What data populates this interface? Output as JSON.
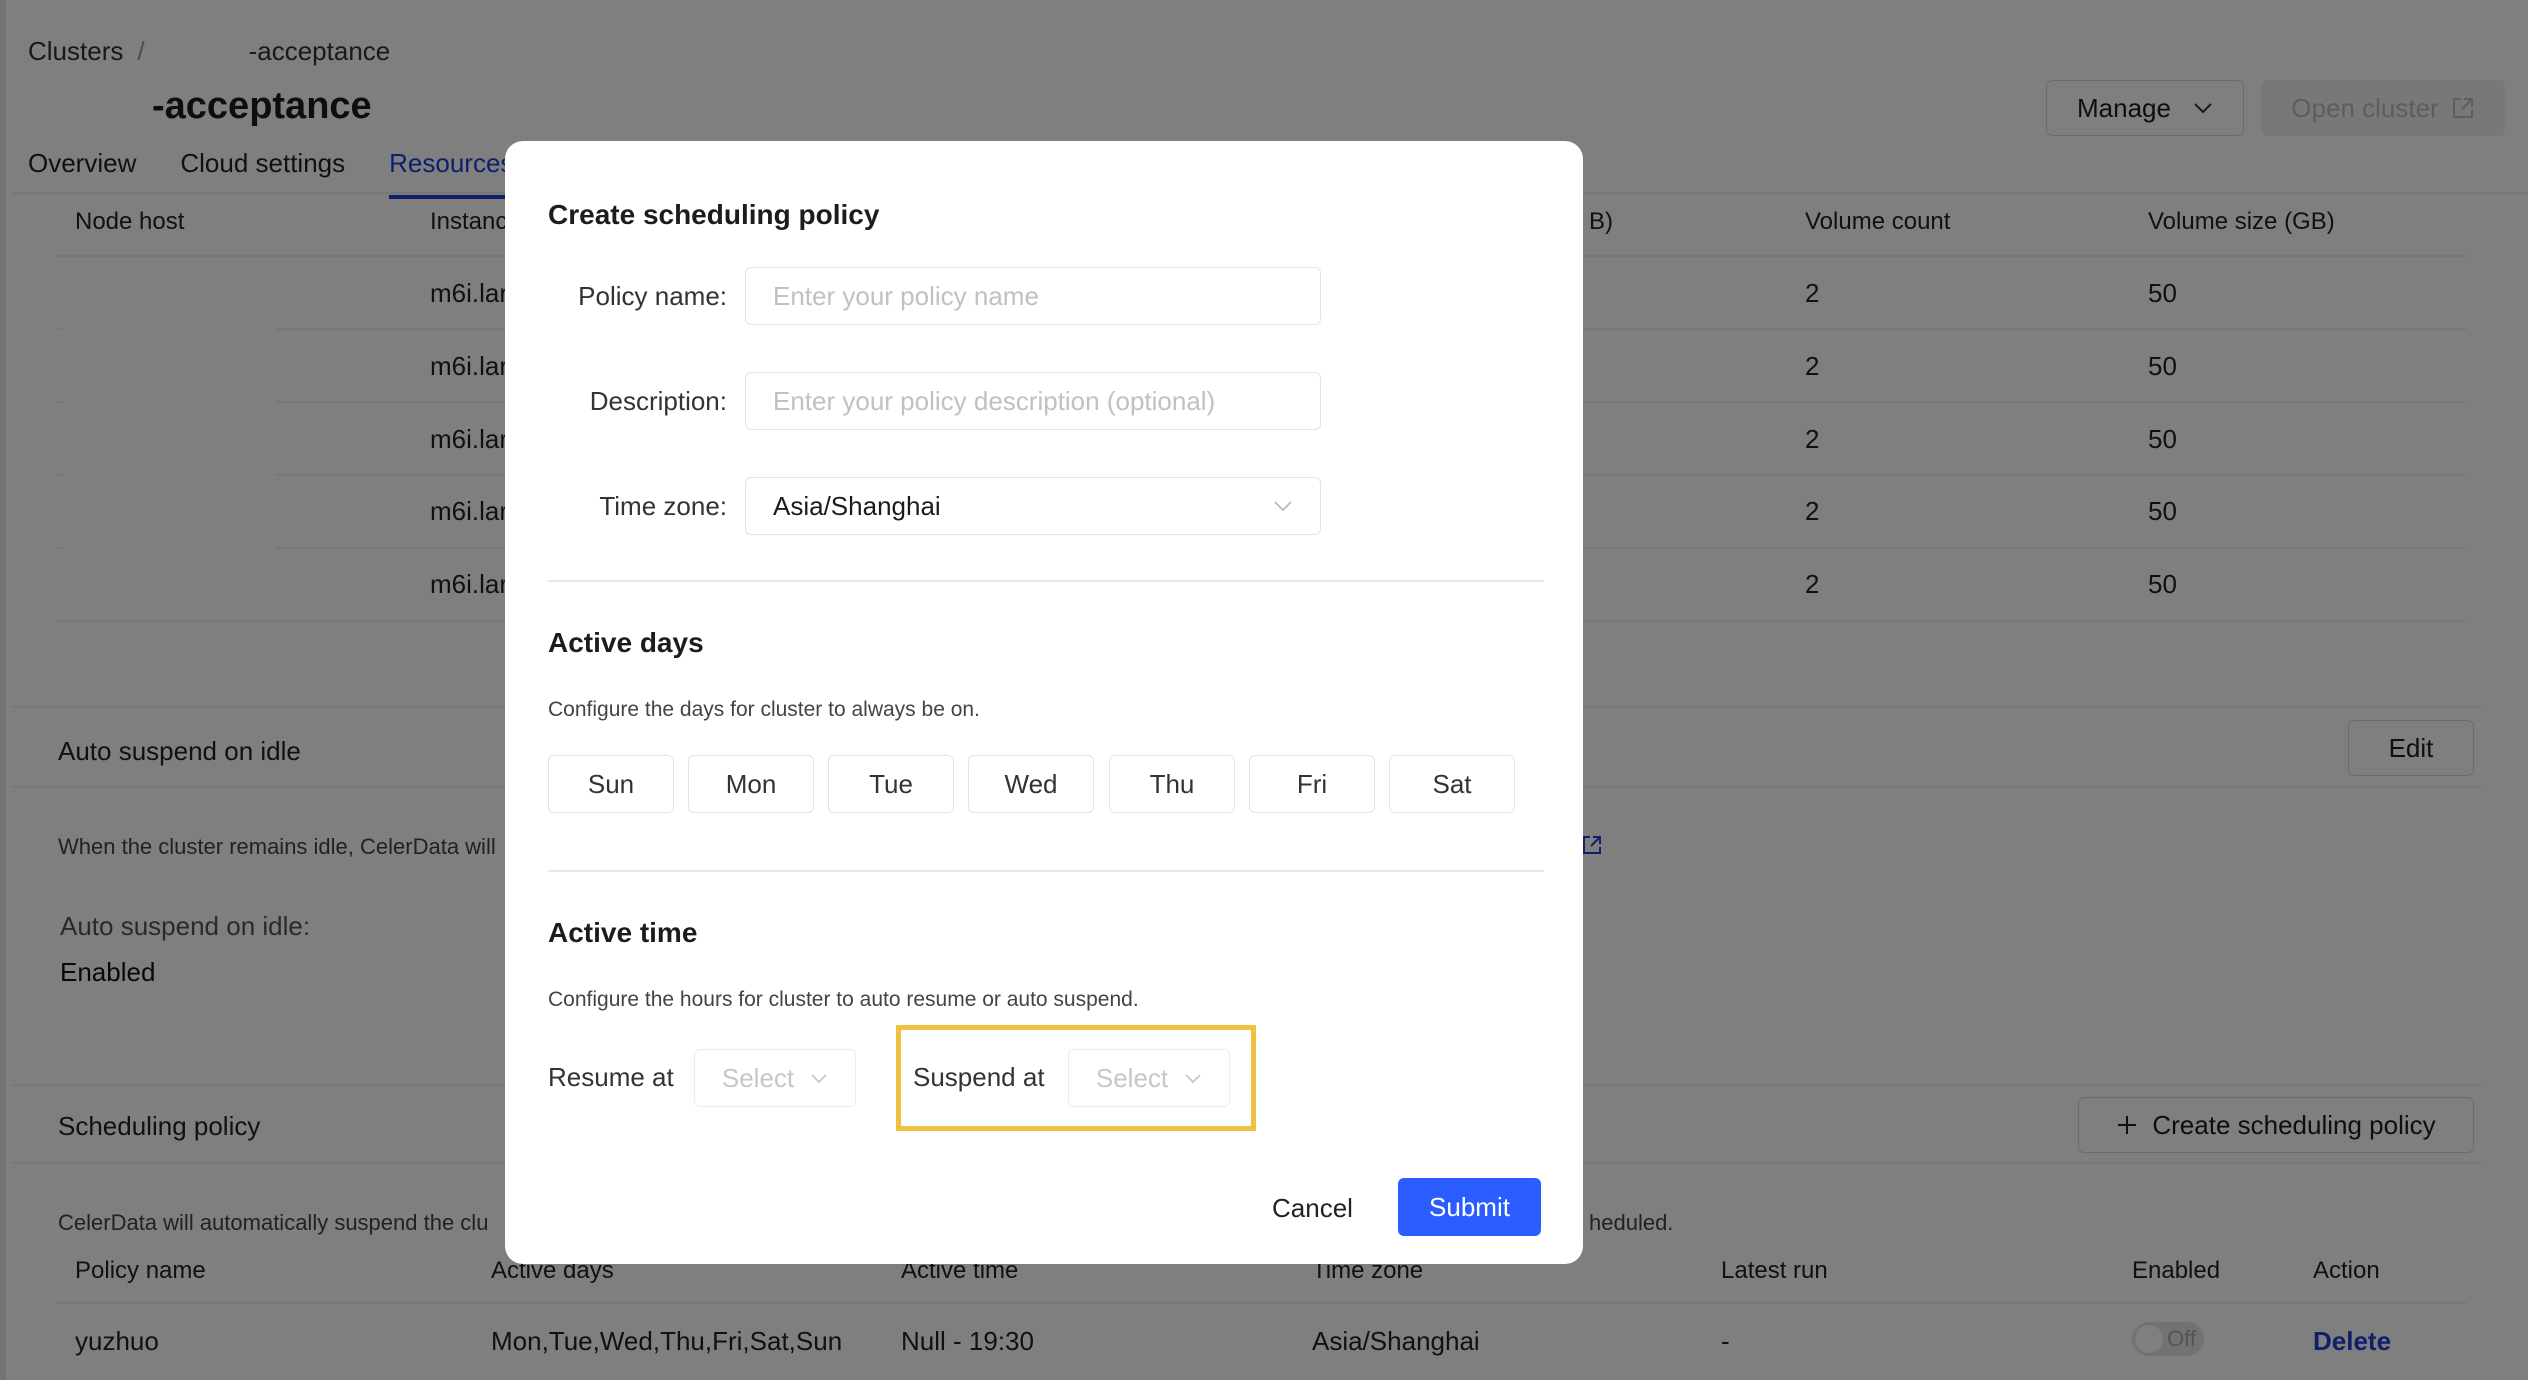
{
  "breadcrumb": {
    "root": "Clusters",
    "separator": "/",
    "current_suffix": "-acceptance"
  },
  "page_title_suffix": "-acceptance",
  "header_actions": {
    "manage": "Manage",
    "open_cluster": "Open cluster"
  },
  "tabs": [
    {
      "label": "Overview",
      "active": false
    },
    {
      "label": "Cloud settings",
      "active": false
    },
    {
      "label": "Resources",
      "active": true
    }
  ],
  "nodes_table": {
    "columns": [
      "Node host",
      "Instance type",
      "(GB)",
      "Volume count",
      "Volume size (GB)"
    ],
    "visible_column_labels": {
      "node_host": "Node host",
      "instance": "Instanc",
      "hidden_partial": "B)",
      "volume_count": "Volume count",
      "volume_size": "Volume size (GB)"
    },
    "rows": [
      {
        "instance": "m6i.lar",
        "volume_count": "2",
        "volume_size": "50"
      },
      {
        "instance": "m6i.lar",
        "volume_count": "2",
        "volume_size": "50"
      },
      {
        "instance": "m6i.lar",
        "volume_count": "2",
        "volume_size": "50"
      },
      {
        "instance": "m6i.lar",
        "volume_count": "2",
        "volume_size": "50"
      },
      {
        "instance": "m6i.lar",
        "volume_count": "2",
        "volume_size": "50"
      }
    ]
  },
  "auto_suspend": {
    "title": "Auto suspend on idle",
    "edit": "Edit",
    "description": "When the cluster remains idle, CelerData will",
    "field_label": "Auto suspend on idle:",
    "field_value": "Enabled"
  },
  "scheduling": {
    "title": "Scheduling policy",
    "create_button": "Create scheduling policy",
    "description_start": "CelerData will automatically suspend the clu",
    "description_end": "heduled.",
    "columns": {
      "policy_name": "Policy name",
      "active_days": "Active days",
      "active_time": "Active time",
      "time_zone": "Time zone",
      "latest_run": "Latest run",
      "enabled": "Enabled",
      "action": "Action"
    },
    "rows": [
      {
        "policy_name": "yuzhuo",
        "active_days": "Mon,Tue,Wed,Thu,Fri,Sat,Sun",
        "active_time": "Null - 19:30",
        "time_zone": "Asia/Shanghai",
        "latest_run": "-",
        "enabled_label": "Off",
        "enabled": false,
        "action": "Delete"
      }
    ]
  },
  "modal": {
    "title": "Create scheduling policy",
    "policy_name_label": "Policy name:",
    "policy_name_placeholder": "Enter your policy name",
    "description_label": "Description:",
    "description_placeholder": "Enter your policy description (optional)",
    "time_zone_label": "Time zone:",
    "time_zone_value": "Asia/Shanghai",
    "active_days_title": "Active days",
    "active_days_desc": "Configure the days for cluster to always be on.",
    "days": [
      "Sun",
      "Mon",
      "Tue",
      "Wed",
      "Thu",
      "Fri",
      "Sat"
    ],
    "active_time_title": "Active time",
    "active_time_desc": "Configure the hours for cluster to auto resume or auto suspend.",
    "resume_label": "Resume at",
    "resume_placeholder": "Select",
    "suspend_label": "Suspend at",
    "suspend_placeholder": "Select",
    "cancel": "Cancel",
    "submit": "Submit"
  },
  "colors": {
    "accent": "#2b5cff",
    "link": "#1e3fd9",
    "highlight": "#f0c040",
    "overlay": "rgba(0,0,0,0.5)"
  }
}
